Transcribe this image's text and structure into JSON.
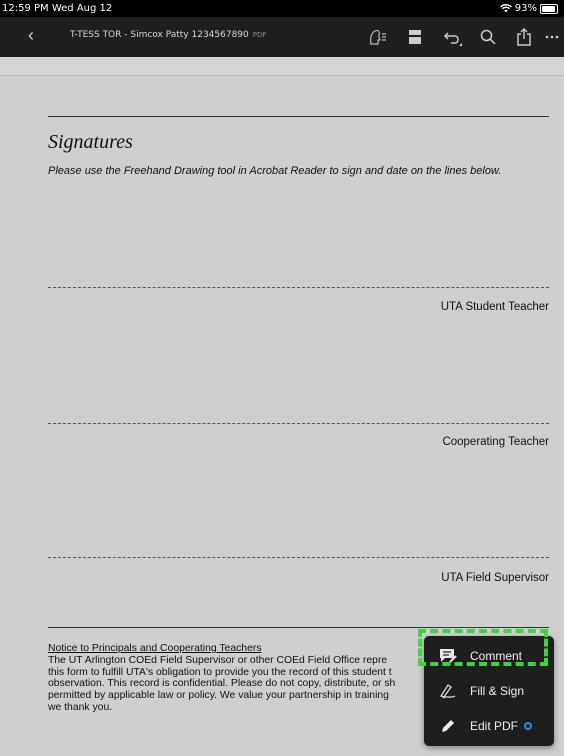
{
  "status_bar": {
    "time": "12:59 PM  Wed Aug 12",
    "battery": "93%"
  },
  "toolbar": {
    "back_icon": "chevron-left-icon",
    "document_name": "T-TESS TOR - Simcox Patty 1234567890",
    "document_ext": "PDF"
  },
  "document": {
    "signatures_title": "Signatures",
    "instructions": "Please use the Freehand Drawing tool in Acrobat Reader to sign and date on the lines below.",
    "signature_lines": [
      {
        "label": "UTA Student Teacher"
      },
      {
        "label": "Cooperating Teacher"
      },
      {
        "label": "UTA Field Supervisor"
      }
    ],
    "notice_heading": "Notice to Principals and Cooperating Teachers",
    "notice_lines": [
      "The UT Arlington COEd Field Supervisor or other COEd Field Office repre",
      "this form to fulfill UTA's obligation to provide you the record of this student t",
      "observation. This record is confidential. Please do not copy, distribute, or sh",
      "permitted by applicable law or policy. We value your partnership in training",
      "we thank you."
    ]
  },
  "menu": {
    "items": [
      {
        "label": "Comment",
        "icon": "comment-icon"
      },
      {
        "label": "Fill & Sign",
        "icon": "fill-sign-icon"
      },
      {
        "label": "Edit PDF",
        "icon": "edit-pencil-icon"
      }
    ],
    "highlight_color": "#3ad63a"
  }
}
